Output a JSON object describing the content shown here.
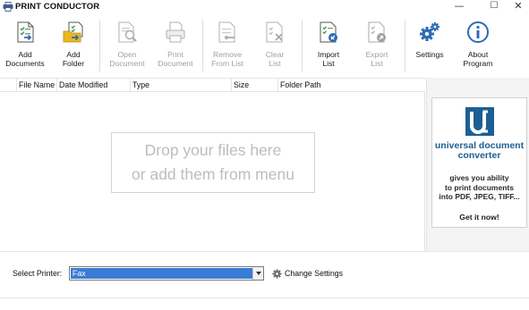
{
  "window": {
    "title": "PRINT CONDUCTOR",
    "minimize_glyph": "—",
    "maximize_glyph": "☐",
    "close_glyph": "✕"
  },
  "toolbar": {
    "add_documents": "Add\nDocuments",
    "add_folder": "Add\nFolder",
    "open_document": "Open\nDocument",
    "print_document": "Print\nDocument",
    "remove_from_list": "Remove\nFrom List",
    "clear_list": "Clear\nList",
    "import_list": "Import\nList",
    "export_list": "Export\nList",
    "settings": "Settings",
    "about_program": "About\nProgram"
  },
  "file_list": {
    "columns": [
      "File Name",
      "Date Modified",
      "Type",
      "Size",
      "Folder Path"
    ],
    "drop_hint_line1": "Drop your files here",
    "drop_hint_line2": "or add them from menu"
  },
  "ad": {
    "title": "universal document\nconverter",
    "description": "gives you ability\nto print documents\ninto PDF, JPEG, TIFF...",
    "cta": "Get it now!"
  },
  "printer": {
    "label": "Select Printer:",
    "selected": "Fax",
    "change_settings": "Change Settings"
  },
  "colors": {
    "accent_blue": "#3a7bd5",
    "ad_blue": "#1c5f93",
    "icon_blue": "#2d6cb5",
    "icon_green": "#3d9a3d",
    "folder_yellow": "#e8b923"
  },
  "icons": {
    "add_documents": "document-add-icon",
    "add_folder": "folder-add-icon",
    "open_document": "document-magnify-icon",
    "print_document": "printer-icon",
    "remove_from_list": "document-remove-icon",
    "clear_list": "list-clear-icon",
    "import_list": "list-import-icon",
    "export_list": "list-export-icon",
    "settings": "gears-icon",
    "about_program": "info-icon"
  }
}
